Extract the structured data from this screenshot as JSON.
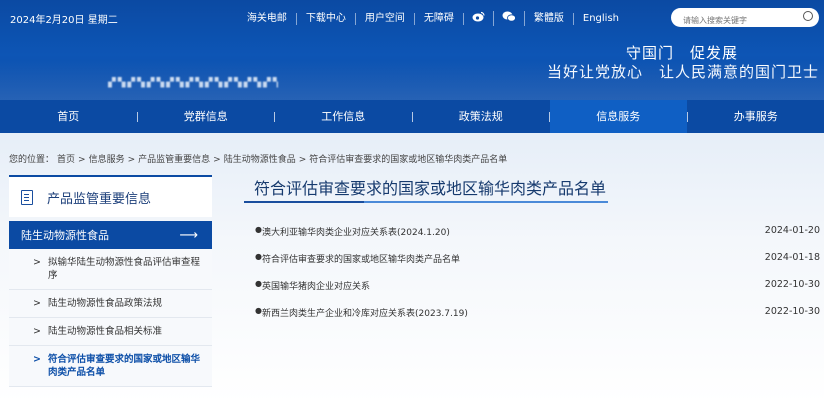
{
  "header": {
    "date": "2024年2月20日 星期二",
    "links": [
      "海关电邮",
      "下载中心",
      "用户空间",
      "无障碍"
    ],
    "icons": [
      "weibo-icon",
      "wechat-icon"
    ],
    "lang_links": [
      "繁體版",
      "English"
    ],
    "search_placeholder": "请输入搜索关键字",
    "slogan_line1": "守国门　促发展",
    "slogan_line2": "当好让党放心　让人民满意的国门卫士"
  },
  "nav": {
    "items": [
      "首页",
      "党群信息",
      "工作信息",
      "政策法规",
      "信息服务",
      "办事服务"
    ],
    "active_index": 4
  },
  "breadcrumb": {
    "label": "您的位置：",
    "items": [
      "首页",
      "信息服务",
      "产品监管重要信息",
      "陆生动物源性食品",
      "符合评估审查要求的国家或地区输华肉类产品名单"
    ],
    "separator": ">"
  },
  "sidebar": {
    "title": "产品监管重要信息",
    "category": "陆生动物源性食品",
    "category_arrow": "⟶",
    "items": [
      {
        "label": "拟输华陆生动物源性食品评估审查程序"
      },
      {
        "label": "陆生动物源性食品政策法规"
      },
      {
        "label": "陆生动物源性食品相关标准"
      },
      {
        "label": "符合评估审查要求的国家或地区输华肉类产品名单"
      }
    ],
    "active_index": 3,
    "marker": ">"
  },
  "main": {
    "title": "符合评估审查要求的国家或地区输华肉类产品名单",
    "bullet": "●",
    "list": [
      {
        "title": "澳大利亚输华肉类企业对应关系表(2024.1.20)",
        "date": "2024-01-20"
      },
      {
        "title": "符合评估审查要求的国家或地区输华肉类产品名单",
        "date": "2024-01-18"
      },
      {
        "title": "英国输华猪肉企业对应关系",
        "date": "2022-10-30"
      },
      {
        "title": "新西兰肉类生产企业和冷库对应关系表(2023.7.19)",
        "date": "2022-10-30"
      }
    ]
  },
  "colors": {
    "header_blue": "#0b4aa3",
    "nav_active": "#0f5fc4",
    "title_text": "#163a6e"
  }
}
